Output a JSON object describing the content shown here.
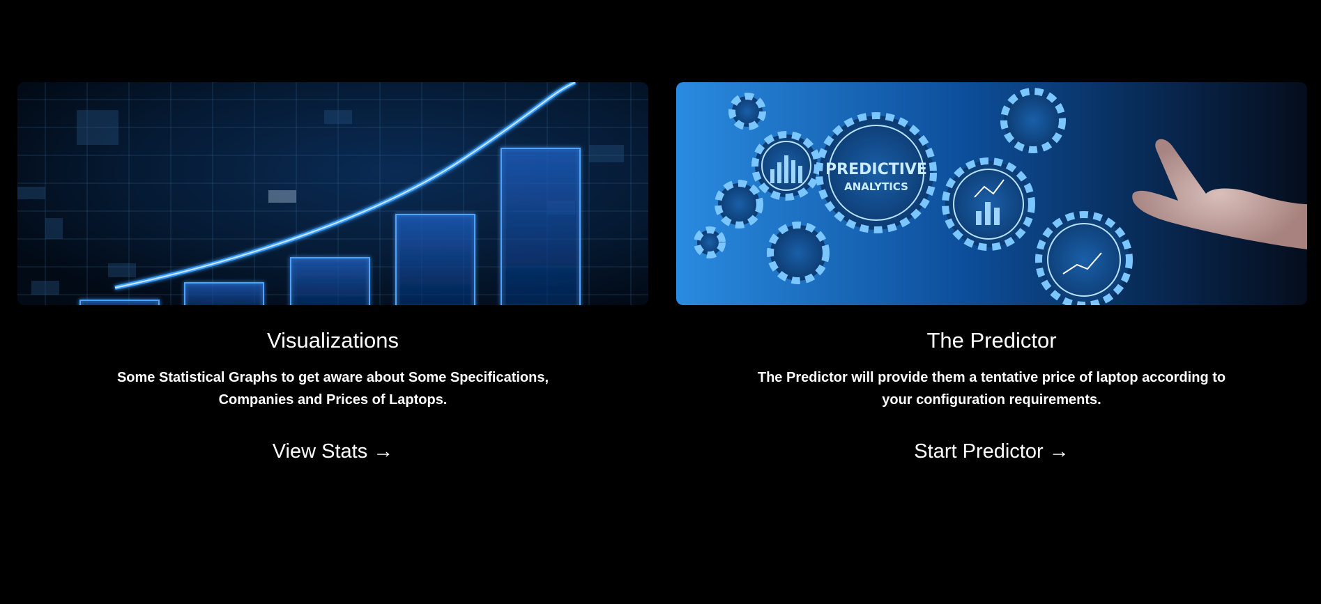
{
  "cards": [
    {
      "title": "Visualizations",
      "description": "Some Statistical Graphs to get aware about Some Specifications, Companies and Prices of Laptops.",
      "link_label": "View Stats →"
    },
    {
      "title": "The Predictor",
      "description": "The Predictor will provide them a tentative price of laptop according to your configuration requirements.",
      "link_label": "Start Predictor →"
    }
  ],
  "hero_right": {
    "gear_title_line1": "PREDICTIVE",
    "gear_title_line2": "ANALYTICS"
  },
  "colors": {
    "background": "#000000",
    "text": "#ffffff",
    "accent_blue": "#1e6fd9",
    "glow_blue": "#3aa0ff"
  }
}
